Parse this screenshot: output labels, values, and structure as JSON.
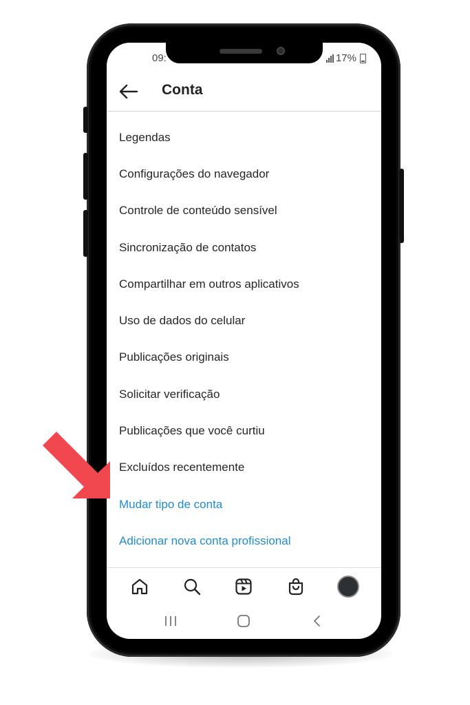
{
  "status_bar": {
    "time": "09:",
    "battery": "17%"
  },
  "header": {
    "title": "Conta",
    "back_icon": "arrow-left-icon"
  },
  "menu": {
    "items": [
      {
        "label": "Legendas"
      },
      {
        "label": "Configurações do navegador"
      },
      {
        "label": "Controle de conteúdo sensível"
      },
      {
        "label": "Sincronização de contatos"
      },
      {
        "label": "Compartilhar em outros aplicativos"
      },
      {
        "label": "Uso de dados do celular"
      },
      {
        "label": "Publicações originais"
      },
      {
        "label": "Solicitar verificação"
      },
      {
        "label": "Publicações que você curtiu"
      },
      {
        "label": "Excluídos recentemente"
      }
    ],
    "links": [
      {
        "label": "Mudar tipo de conta"
      },
      {
        "label": "Adicionar nova conta profissional"
      }
    ]
  },
  "tab_bar": {
    "icons": [
      "home-icon",
      "search-icon",
      "reels-icon",
      "shop-icon",
      "profile-avatar"
    ]
  },
  "colors": {
    "link": "#1f8ccf",
    "arrow": "#f0484e",
    "text": "#262626"
  }
}
